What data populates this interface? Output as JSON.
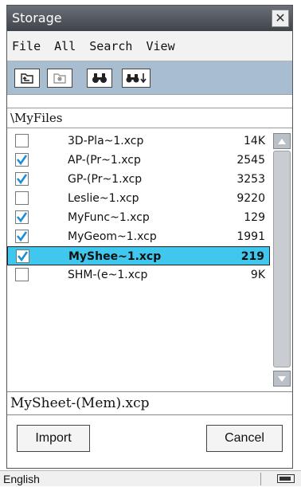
{
  "window": {
    "title": "Storage",
    "close_glyph": "✕"
  },
  "menu": [
    "File",
    "All",
    "Search",
    "View"
  ],
  "toolbar": {
    "background": "#a8bdd0",
    "tools": [
      "back-folder-icon",
      "new-folder-icon",
      "search-icon",
      "search-next-icon"
    ]
  },
  "path": "\\MyFiles",
  "files": [
    {
      "name": "3D-Pla~1.xcp",
      "size": "14K",
      "checked": false,
      "selected": false
    },
    {
      "name": "AP-(Pr~1.xcp",
      "size": "2545",
      "checked": true,
      "selected": false
    },
    {
      "name": "GP-(Pr~1.xcp",
      "size": "3253",
      "checked": true,
      "selected": false
    },
    {
      "name": "Leslie~1.xcp",
      "size": "9220",
      "checked": false,
      "selected": false
    },
    {
      "name": "MyFunc~1.xcp",
      "size": "129",
      "checked": true,
      "selected": false
    },
    {
      "name": "MyGeom~1.xcp",
      "size": "1991",
      "checked": true,
      "selected": false
    },
    {
      "name": "MyShee~1.xcp",
      "size": "219",
      "checked": true,
      "selected": true
    },
    {
      "name": "SHM-(e~1.xcp",
      "size": "9K",
      "checked": false,
      "selected": false
    }
  ],
  "selected_color": "#3fc7ee",
  "check_color": "#1a8fd8",
  "filename_value": "MySheet-(Mem).xcp",
  "buttons": {
    "import": "Import",
    "cancel": "Cancel"
  },
  "status": {
    "language": "English",
    "battery_icon": "battery-icon"
  }
}
